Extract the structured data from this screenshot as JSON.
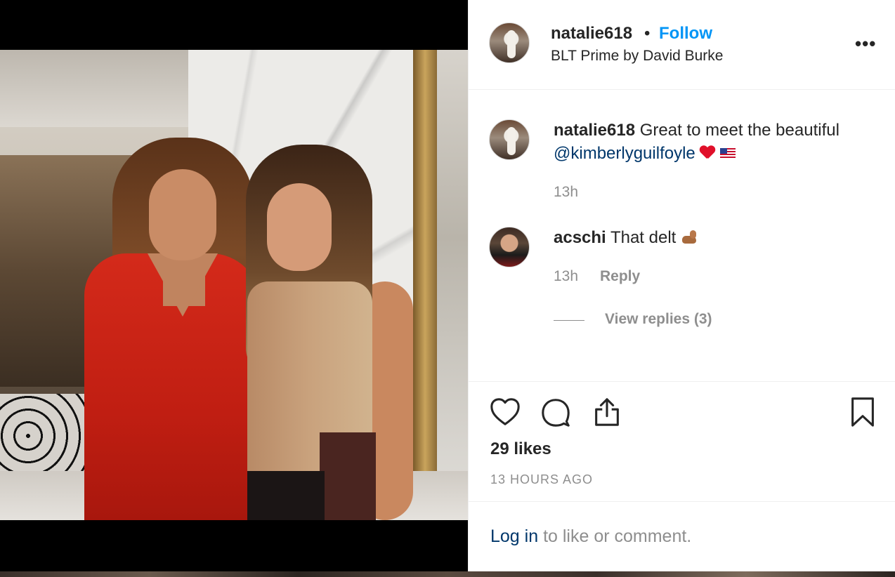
{
  "post": {
    "username": "natalie618",
    "separator": "•",
    "follow_label": "Follow",
    "location": "BLT Prime by David Burke",
    "more_label": "•••"
  },
  "comments": [
    {
      "username": "natalie618",
      "text_before": "Great to meet the beautiful",
      "mention": "@kimberlyguilfoyle",
      "emojis": [
        "red-heart",
        "us-flag"
      ],
      "time": "13h"
    },
    {
      "username": "acschi",
      "text_before": "That delt",
      "emojis": [
        "flexed-biceps"
      ],
      "time": "13h",
      "reply_label": "Reply",
      "view_replies_label": "View replies (3)"
    }
  ],
  "actions": {
    "icons": [
      "heart-icon",
      "comment-icon",
      "share-icon",
      "bookmark-icon"
    ],
    "likes": "29 likes",
    "time_ago": "13 HOURS AGO"
  },
  "login": {
    "link_label": "Log in",
    "suffix": " to like or comment."
  },
  "colors": {
    "link_blue": "#0095f6",
    "mention_blue": "#00376b",
    "muted_gray": "#8e8e8e",
    "text_dark": "#262626"
  }
}
